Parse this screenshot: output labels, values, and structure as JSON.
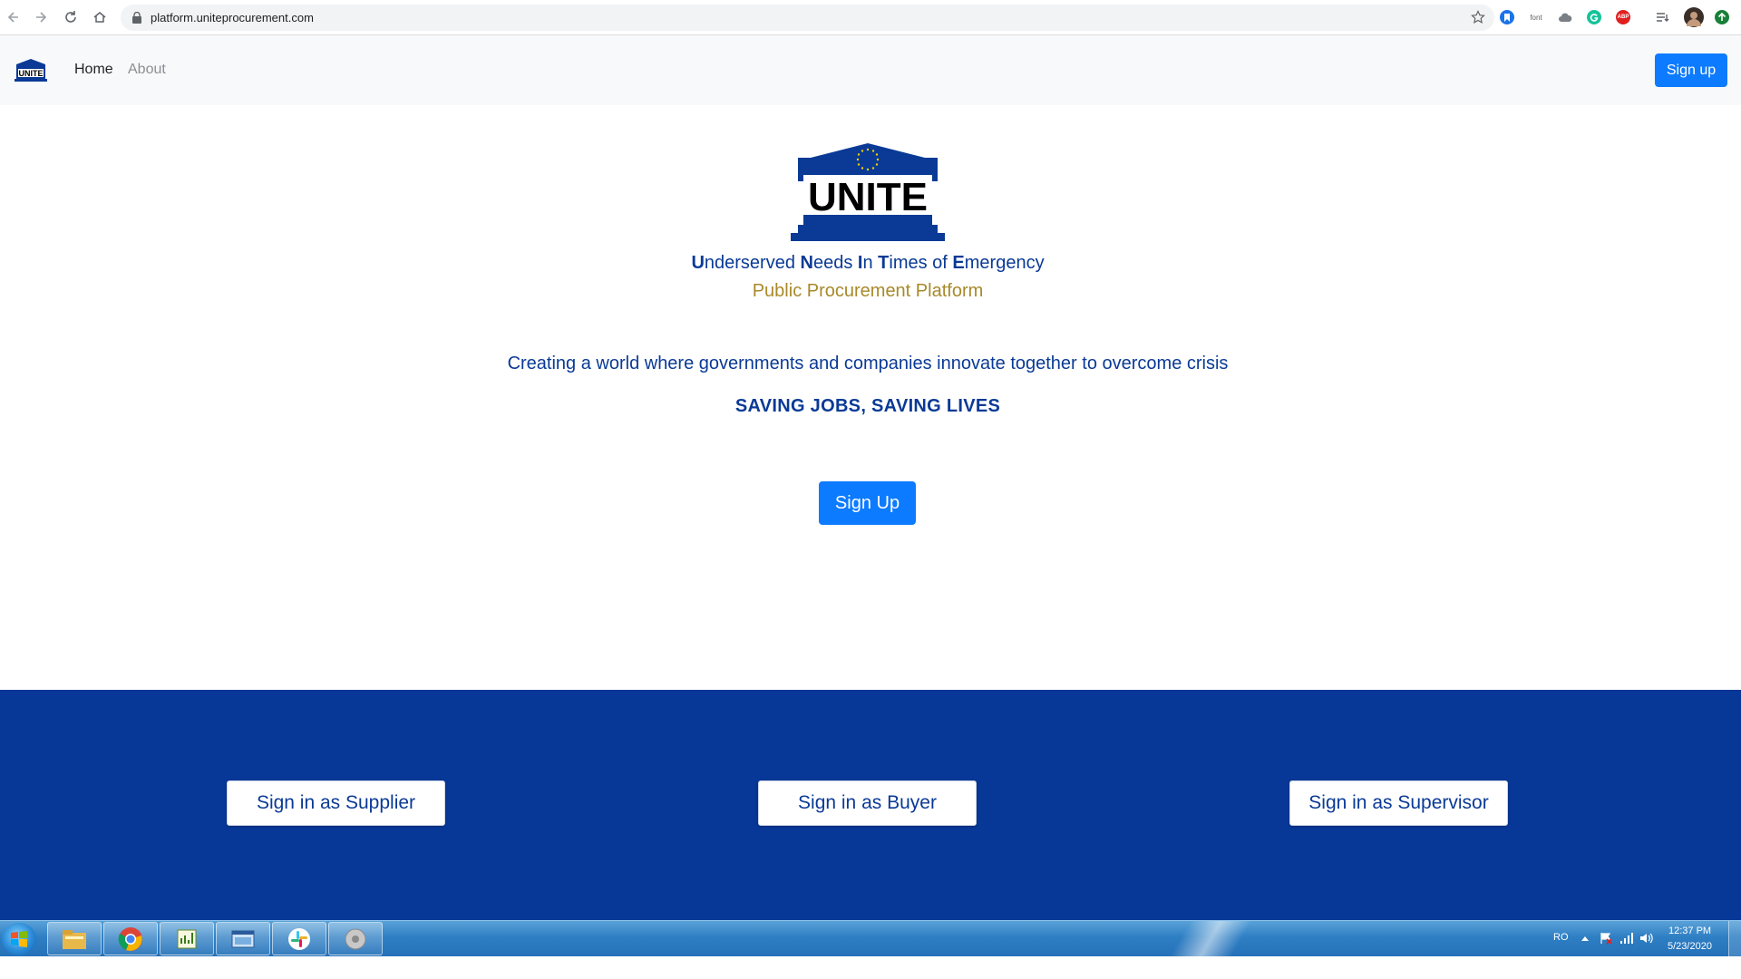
{
  "browser": {
    "url": "platform.uniteprocurement.com",
    "extensions": [
      "bookmark-extension-icon",
      "font-extension-icon",
      "cloud-extension-icon",
      "grammarly-extension-icon",
      "adblock-extension-icon",
      "reading-list-icon",
      "profile-avatar",
      "update-icon"
    ],
    "font_ext_label": "font",
    "abp_label": "ABP"
  },
  "navbar": {
    "logo_text": "UNITE",
    "links": [
      {
        "label": "Home",
        "active": true
      },
      {
        "label": "About",
        "active": false
      }
    ],
    "signup_label": "Sign up"
  },
  "hero": {
    "logo_text": "UNITE",
    "acronym_parts": [
      {
        "bold": "U",
        "rest": "nderserved "
      },
      {
        "bold": "N",
        "rest": "eeds "
      },
      {
        "bold": "I",
        "rest": "n "
      },
      {
        "bold": "T",
        "rest": "imes of "
      },
      {
        "bold": "E",
        "rest": "mergency"
      }
    ],
    "subtitle": "Public Procurement Platform",
    "mission": "Creating a world where governments and companies innovate together to overcome crisis",
    "motto": "SAVING JOBS, SAVING LIVES",
    "signup_label": "Sign Up"
  },
  "signin": {
    "supplier_label": "Sign in as Supplier",
    "buyer_label": "Sign in as Buyer",
    "supervisor_label": "Sign in as Supervisor"
  },
  "taskbar": {
    "apps": [
      "file-explorer-icon",
      "chrome-icon",
      "notepad-chart-icon",
      "window-app-icon",
      "slack-icon",
      "media-player-icon"
    ],
    "language": "RO",
    "time": "12:37 PM",
    "date": "5/23/2020"
  },
  "colors": {
    "brand_blue": "#073797",
    "primary_button": "#0d7bff",
    "gold": "#a8892a"
  }
}
